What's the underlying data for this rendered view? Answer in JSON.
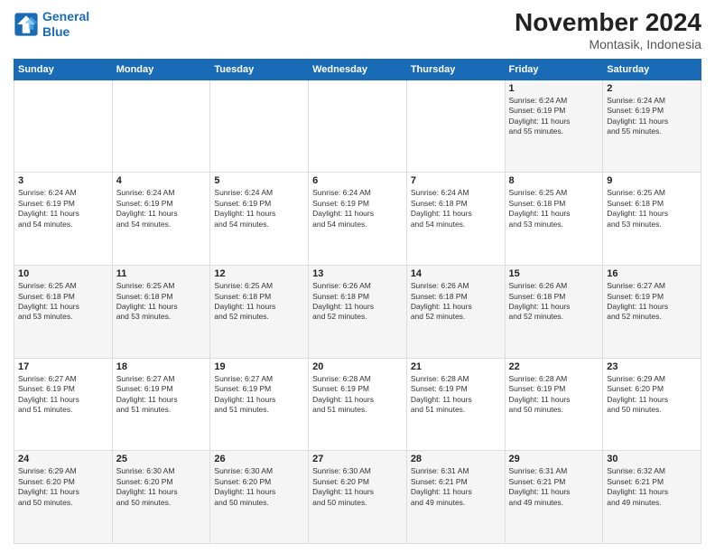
{
  "header": {
    "logo_line1": "General",
    "logo_line2": "Blue",
    "month_year": "November 2024",
    "location": "Montasik, Indonesia"
  },
  "days_of_week": [
    "Sunday",
    "Monday",
    "Tuesday",
    "Wednesday",
    "Thursday",
    "Friday",
    "Saturday"
  ],
  "weeks": [
    [
      {
        "day": "",
        "info": ""
      },
      {
        "day": "",
        "info": ""
      },
      {
        "day": "",
        "info": ""
      },
      {
        "day": "",
        "info": ""
      },
      {
        "day": "",
        "info": ""
      },
      {
        "day": "1",
        "info": "Sunrise: 6:24 AM\nSunset: 6:19 PM\nDaylight: 11 hours\nand 55 minutes."
      },
      {
        "day": "2",
        "info": "Sunrise: 6:24 AM\nSunset: 6:19 PM\nDaylight: 11 hours\nand 55 minutes."
      }
    ],
    [
      {
        "day": "3",
        "info": "Sunrise: 6:24 AM\nSunset: 6:19 PM\nDaylight: 11 hours\nand 54 minutes."
      },
      {
        "day": "4",
        "info": "Sunrise: 6:24 AM\nSunset: 6:19 PM\nDaylight: 11 hours\nand 54 minutes."
      },
      {
        "day": "5",
        "info": "Sunrise: 6:24 AM\nSunset: 6:19 PM\nDaylight: 11 hours\nand 54 minutes."
      },
      {
        "day": "6",
        "info": "Sunrise: 6:24 AM\nSunset: 6:19 PM\nDaylight: 11 hours\nand 54 minutes."
      },
      {
        "day": "7",
        "info": "Sunrise: 6:24 AM\nSunset: 6:18 PM\nDaylight: 11 hours\nand 54 minutes."
      },
      {
        "day": "8",
        "info": "Sunrise: 6:25 AM\nSunset: 6:18 PM\nDaylight: 11 hours\nand 53 minutes."
      },
      {
        "day": "9",
        "info": "Sunrise: 6:25 AM\nSunset: 6:18 PM\nDaylight: 11 hours\nand 53 minutes."
      }
    ],
    [
      {
        "day": "10",
        "info": "Sunrise: 6:25 AM\nSunset: 6:18 PM\nDaylight: 11 hours\nand 53 minutes."
      },
      {
        "day": "11",
        "info": "Sunrise: 6:25 AM\nSunset: 6:18 PM\nDaylight: 11 hours\nand 53 minutes."
      },
      {
        "day": "12",
        "info": "Sunrise: 6:25 AM\nSunset: 6:18 PM\nDaylight: 11 hours\nand 52 minutes."
      },
      {
        "day": "13",
        "info": "Sunrise: 6:26 AM\nSunset: 6:18 PM\nDaylight: 11 hours\nand 52 minutes."
      },
      {
        "day": "14",
        "info": "Sunrise: 6:26 AM\nSunset: 6:18 PM\nDaylight: 11 hours\nand 52 minutes."
      },
      {
        "day": "15",
        "info": "Sunrise: 6:26 AM\nSunset: 6:18 PM\nDaylight: 11 hours\nand 52 minutes."
      },
      {
        "day": "16",
        "info": "Sunrise: 6:27 AM\nSunset: 6:19 PM\nDaylight: 11 hours\nand 52 minutes."
      }
    ],
    [
      {
        "day": "17",
        "info": "Sunrise: 6:27 AM\nSunset: 6:19 PM\nDaylight: 11 hours\nand 51 minutes."
      },
      {
        "day": "18",
        "info": "Sunrise: 6:27 AM\nSunset: 6:19 PM\nDaylight: 11 hours\nand 51 minutes."
      },
      {
        "day": "19",
        "info": "Sunrise: 6:27 AM\nSunset: 6:19 PM\nDaylight: 11 hours\nand 51 minutes."
      },
      {
        "day": "20",
        "info": "Sunrise: 6:28 AM\nSunset: 6:19 PM\nDaylight: 11 hours\nand 51 minutes."
      },
      {
        "day": "21",
        "info": "Sunrise: 6:28 AM\nSunset: 6:19 PM\nDaylight: 11 hours\nand 51 minutes."
      },
      {
        "day": "22",
        "info": "Sunrise: 6:28 AM\nSunset: 6:19 PM\nDaylight: 11 hours\nand 50 minutes."
      },
      {
        "day": "23",
        "info": "Sunrise: 6:29 AM\nSunset: 6:20 PM\nDaylight: 11 hours\nand 50 minutes."
      }
    ],
    [
      {
        "day": "24",
        "info": "Sunrise: 6:29 AM\nSunset: 6:20 PM\nDaylight: 11 hours\nand 50 minutes."
      },
      {
        "day": "25",
        "info": "Sunrise: 6:30 AM\nSunset: 6:20 PM\nDaylight: 11 hours\nand 50 minutes."
      },
      {
        "day": "26",
        "info": "Sunrise: 6:30 AM\nSunset: 6:20 PM\nDaylight: 11 hours\nand 50 minutes."
      },
      {
        "day": "27",
        "info": "Sunrise: 6:30 AM\nSunset: 6:20 PM\nDaylight: 11 hours\nand 50 minutes."
      },
      {
        "day": "28",
        "info": "Sunrise: 6:31 AM\nSunset: 6:21 PM\nDaylight: 11 hours\nand 49 minutes."
      },
      {
        "day": "29",
        "info": "Sunrise: 6:31 AM\nSunset: 6:21 PM\nDaylight: 11 hours\nand 49 minutes."
      },
      {
        "day": "30",
        "info": "Sunrise: 6:32 AM\nSunset: 6:21 PM\nDaylight: 11 hours\nand 49 minutes."
      }
    ]
  ]
}
